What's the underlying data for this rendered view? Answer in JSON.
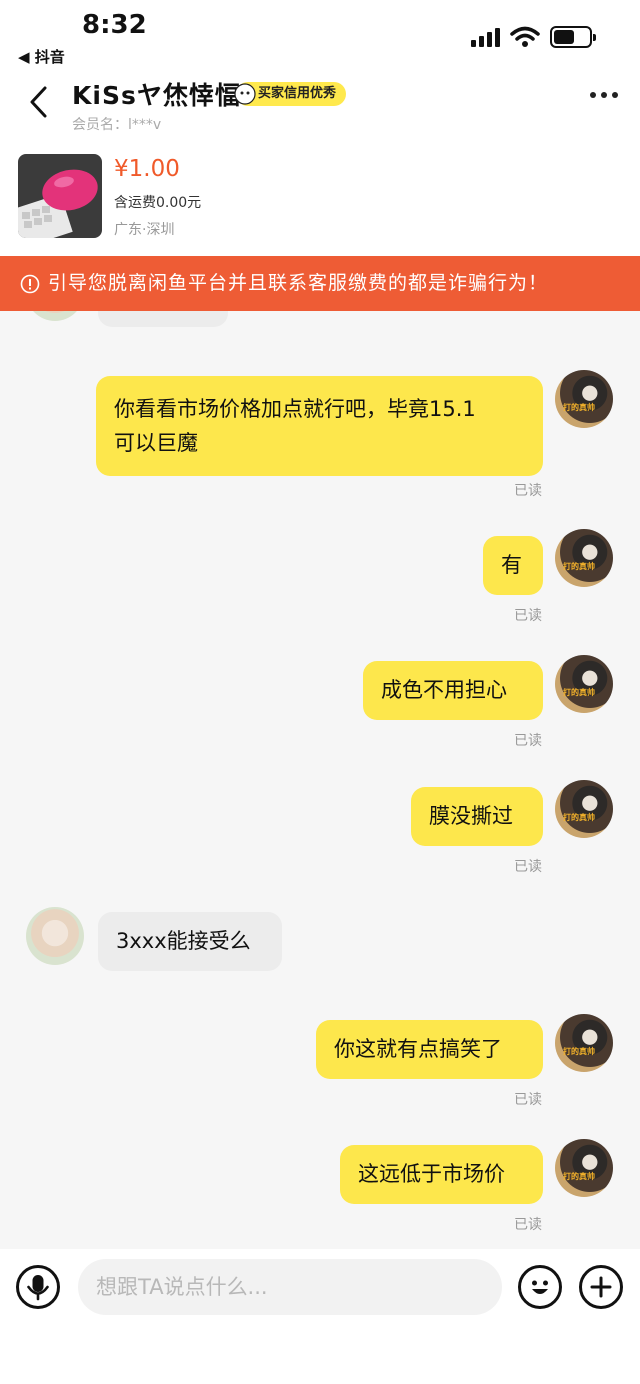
{
  "status_bar": {
    "time": "8:32",
    "back_app": "◀ 抖音"
  },
  "header": {
    "title": "KiSsヤ烋悻愊",
    "credit_badge": "买家信用优秀",
    "member": "会员名：l***v"
  },
  "product": {
    "price": "¥1.00",
    "shipping": "含运费0.00元",
    "location": "广东·深圳"
  },
  "warning": "引导您脱离闲鱼平台并且联系客服缴费的都是诈骗行为！",
  "messages": [
    {
      "from": "me",
      "text_line1": "你看看市场价格加点就行吧，毕竟15.1",
      "text_line2": "可以巨魔",
      "read": "已读"
    },
    {
      "from": "me",
      "text": "有",
      "read": "已读"
    },
    {
      "from": "me",
      "text": "成色不用担心",
      "read": "已读"
    },
    {
      "from": "me",
      "text": "膜没撕过",
      "read": "已读"
    },
    {
      "from": "other",
      "text": "3xxx能接受么"
    },
    {
      "from": "me",
      "text": "你这就有点搞笑了",
      "read": "已读"
    },
    {
      "from": "me",
      "text": "这远低于市场价",
      "read": "已读"
    }
  ],
  "input": {
    "placeholder": "想跟TA说点什么..."
  },
  "icons": [
    "back-icon",
    "more-icon",
    "warning-icon",
    "microphone-icon",
    "emoji-icon",
    "plus-icon"
  ],
  "colors": {
    "accent": "#fde74c",
    "warning_bg": "#ee5c35",
    "price": "#f05a2a"
  }
}
